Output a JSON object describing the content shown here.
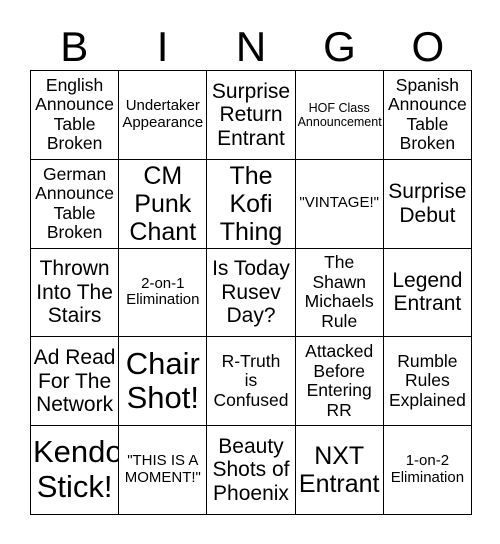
{
  "card": {
    "title_letters": [
      "B",
      "I",
      "N",
      "G",
      "O"
    ],
    "rows": [
      [
        {
          "text": "English\nAnnounce\nTable\nBroken",
          "size": "md"
        },
        {
          "text": "Undertaker\nAppearance",
          "size": "sm"
        },
        {
          "text": "Surprise\nReturn\nEntrant",
          "size": "lg"
        },
        {
          "text": "HOF Class\nAnnouncement",
          "size": "xs"
        },
        {
          "text": "Spanish\nAnnounce\nTable\nBroken",
          "size": "md"
        }
      ],
      [
        {
          "text": "German\nAnnounce\nTable\nBroken",
          "size": "md"
        },
        {
          "text": "CM\nPunk\nChant",
          "size": "xl"
        },
        {
          "text": "The\nKofi\nThing",
          "size": "xl"
        },
        {
          "text": "\"VINTAGE!\"",
          "size": "sm"
        },
        {
          "text": "Surprise\nDebut",
          "size": "lg"
        }
      ],
      [
        {
          "text": "Thrown\nInto The\nStairs",
          "size": "lg"
        },
        {
          "text": "2-on-1\nElimination",
          "size": "sm"
        },
        {
          "text": "Is Today\nRusev\nDay?",
          "size": "lg"
        },
        {
          "text": "The\nShawn\nMichaels\nRule",
          "size": "md"
        },
        {
          "text": "Legend\nEntrant",
          "size": "lg"
        }
      ],
      [
        {
          "text": "Ad Read\nFor The\nNetwork",
          "size": "lg"
        },
        {
          "text": "Chair\nShot!",
          "size": "xxl"
        },
        {
          "text": "R-Truth\nis\nConfused",
          "size": "md"
        },
        {
          "text": "Attacked\nBefore\nEntering\nRR",
          "size": "md"
        },
        {
          "text": "Rumble\nRules\nExplained",
          "size": "md"
        }
      ],
      [
        {
          "text": "Kendo\nStick!",
          "size": "xxl"
        },
        {
          "text": "\"THIS IS A\nMOMENT!\"",
          "size": "sm"
        },
        {
          "text": "Beauty\nShots of\nPhoenix",
          "size": "lg"
        },
        {
          "text": "NXT\nEntrant",
          "size": "xl"
        },
        {
          "text": "1-on-2\nElimination",
          "size": "sm"
        }
      ]
    ]
  }
}
